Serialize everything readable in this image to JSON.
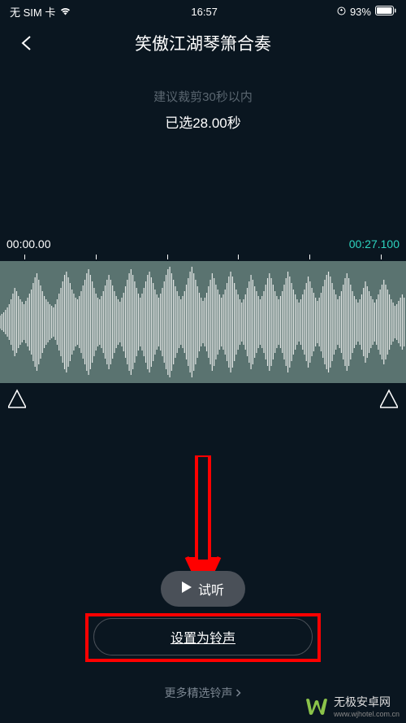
{
  "status_bar": {
    "sim": "无 SIM 卡",
    "time": "16:57",
    "battery": "93%"
  },
  "nav": {
    "title": "笑傲江湖琴箫合奏"
  },
  "info": {
    "hint": "建议裁剪30秒以内",
    "selected": "已选28.00秒"
  },
  "waveform": {
    "start_time": "00:00.00",
    "end_time": "00:27.100"
  },
  "buttons": {
    "preview": "试听",
    "set_ringtone": "设置为铃声",
    "more_ringtones": "更多精选铃声"
  },
  "watermark": {
    "text": "无极安卓网",
    "url": "www.wjhotel.com.cn"
  }
}
